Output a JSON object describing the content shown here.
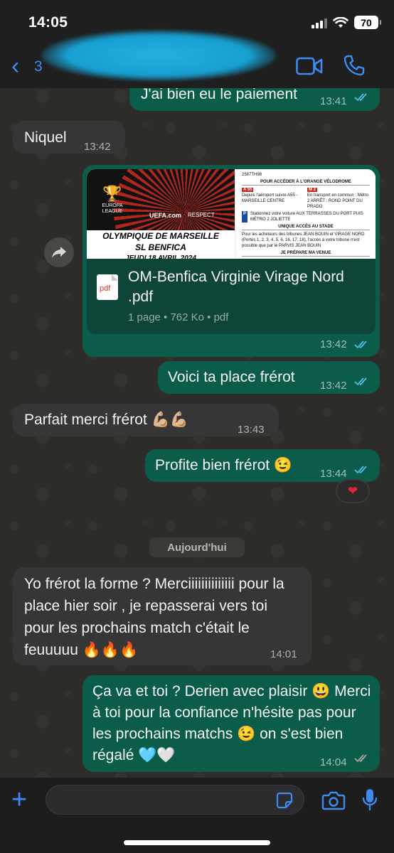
{
  "status_bar": {
    "time": "14:05",
    "battery": "70"
  },
  "header": {
    "back_count": "3"
  },
  "messages": [
    {
      "id": "m0",
      "dir": "out",
      "text": "J'ai bien eu le paiement",
      "time": "13:41",
      "read": true
    },
    {
      "id": "m1",
      "dir": "in",
      "text": "Niquel",
      "time": "13:42"
    },
    {
      "id": "m3",
      "dir": "out",
      "text": "Voici ta place frérot",
      "time": "13:42",
      "read": true
    },
    {
      "id": "m4",
      "dir": "in",
      "text": "Parfait merci frérot 💪🏼💪🏼",
      "time": "13:43"
    },
    {
      "id": "m5",
      "dir": "out",
      "text": "Profite bien frérot 😉",
      "time": "13:44",
      "read": true,
      "reaction": "❤"
    },
    {
      "id": "m6",
      "dir": "in",
      "text": "Yo frérot la forme ? Merciiiiiiiiiiiiii pour la place hier soir , je repasserai vers toi pour les prochains match c'était le feuuuuu 🔥🔥🔥",
      "time": "14:01"
    },
    {
      "id": "m7",
      "dir": "out",
      "text": "Ça va et toi ? Derien avec plaisir 😃 Merci à toi pour la confiance n'hésite pas pour les prochains matchs 😉 on s'est bien régalé 🩵🤍",
      "time": "14:04",
      "read": false
    }
  ],
  "document": {
    "file_name": "OM-Benfica Virginie Virage Nord .pdf",
    "meta": "1 page • 762 Ko • pdf",
    "time": "13:42",
    "file_type": "pdf",
    "preview": {
      "competition": "EUROPA LEAGUE",
      "uefa": "UEFA.com",
      "respect": "RESPECT",
      "match_line1": "OLYMPIQUE DE MARSEILLE",
      "match_line2": "SL BENFICA",
      "match_line3": "JEUDI 18 AVRIL 2024",
      "ref": "2567TH98",
      "title": "POUR ACCÉDER À L'ORANGE VÉLODROME",
      "a55": "A 55",
      "metro": "M 2",
      "col1": "Depuis l'aéroport suivre A55 - MARSEILLE CENTRE",
      "col2": "En transport en commun : Métro 2 ARRÊT : ROND POINT DU PRADO",
      "parking": "Stationnez votre voiture AUX TERRASSES DU PORT PUIS MÉTRO 2 JOLIETTE",
      "access_title": "UNIQUE ACCÈS AU STADE",
      "access_text": "Pour les acheteurs des tribunes JEAN BOUIN et VIRAGE NORD (Portes 1, 2, 3, 4, 5, 6, 16, 17, 18), l'accès à votre tribune n'est possible que par le PARVIS JEAN BOUIN",
      "footer": "JE PRÉPARE MA VENUE"
    }
  },
  "date_separator": "Aujourd'hui",
  "input": {
    "placeholder": ""
  },
  "colors": {
    "outgoing": "#0c5c4a",
    "incoming": "#363636",
    "accent": "#3d8bf0",
    "read_ticks": "#53bdeb"
  },
  "icons": [
    "chevron-left-icon",
    "video-camera-icon",
    "phone-icon",
    "forward-icon",
    "pdf-icon",
    "plus-icon",
    "sticker-icon",
    "camera-icon",
    "microphone-icon",
    "heart-icon"
  ]
}
